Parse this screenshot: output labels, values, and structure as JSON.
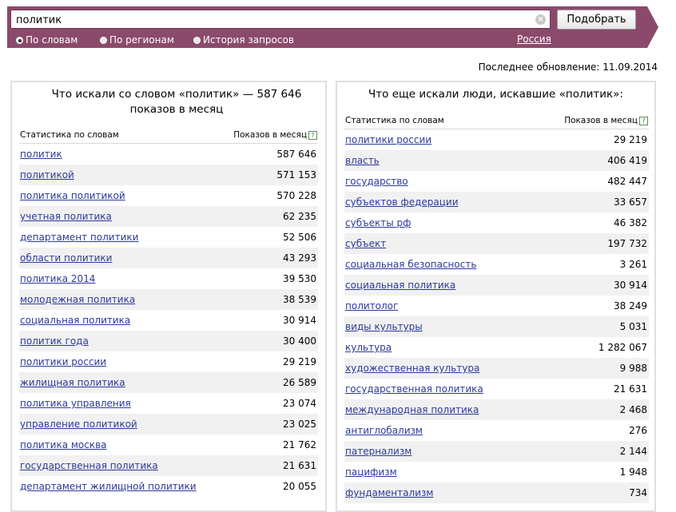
{
  "search": {
    "query": "политик",
    "clear_glyph": "×",
    "submit_label": "Подобрать"
  },
  "tabs": [
    {
      "label": "По словам",
      "selected": true
    },
    {
      "label": "По регионам",
      "selected": false
    },
    {
      "label": "История запросов",
      "selected": false
    }
  ],
  "region": "Россия",
  "update": "Последнее обновление: 11.09.2014",
  "left": {
    "title": "Что искали со словом «политик» — 587 646 показов в месяц",
    "col_word": "Статистика по словам",
    "col_count": "Показов в месяц",
    "help_glyph": "?",
    "rows": [
      {
        "word": "политик",
        "count": "587 646"
      },
      {
        "word": "политикой",
        "count": "571 153"
      },
      {
        "word": "политика политикой",
        "count": "570 228"
      },
      {
        "word": "учетная политика",
        "count": "62 235"
      },
      {
        "word": "департамент политики",
        "count": "52 506"
      },
      {
        "word": "области политики",
        "count": "43 293"
      },
      {
        "word": "политика 2014",
        "count": "39 530"
      },
      {
        "word": "молодежная политика",
        "count": "38 539"
      },
      {
        "word": "социальная политика",
        "count": "30 914"
      },
      {
        "word": "политик года",
        "count": "30 400"
      },
      {
        "word": "политики россии",
        "count": "29 219"
      },
      {
        "word": "жилищная политика",
        "count": "26 589"
      },
      {
        "word": "политика управления",
        "count": "23 074"
      },
      {
        "word": "управление политикой",
        "count": "23 025"
      },
      {
        "word": "политика москва",
        "count": "21 762"
      },
      {
        "word": "государственная политика",
        "count": "21 631"
      },
      {
        "word": "департамент жилищной политики",
        "count": "20 055"
      }
    ]
  },
  "right": {
    "title": "Что еще искали люди, искавшие «политик»:",
    "col_word": "Статистика по словам",
    "col_count": "Показов в месяц",
    "help_glyph": "?",
    "rows": [
      {
        "word": "политики россии",
        "count": "29 219"
      },
      {
        "word": "власть",
        "count": "406 419"
      },
      {
        "word": "государство",
        "count": "482 447"
      },
      {
        "word": "субъектов федерации",
        "count": "33 657"
      },
      {
        "word": "субъекты рф",
        "count": "46 382"
      },
      {
        "word": "субъект",
        "count": "197 732"
      },
      {
        "word": "социальная безопасность",
        "count": "3 261"
      },
      {
        "word": "социальная политика",
        "count": "30 914"
      },
      {
        "word": "политолог",
        "count": "38 249"
      },
      {
        "word": "виды культуры",
        "count": "5 031"
      },
      {
        "word": "культура",
        "count": "1 282 067"
      },
      {
        "word": "художественная культура",
        "count": "9 988"
      },
      {
        "word": "государственная политика",
        "count": "21 631"
      },
      {
        "word": "международная политика",
        "count": "2 468"
      },
      {
        "word": "антиглобализм",
        "count": "276"
      },
      {
        "word": "патернализм",
        "count": "2 144"
      },
      {
        "word": "пацифизм",
        "count": "1 948"
      },
      {
        "word": "фундаментализм",
        "count": "734"
      }
    ]
  }
}
